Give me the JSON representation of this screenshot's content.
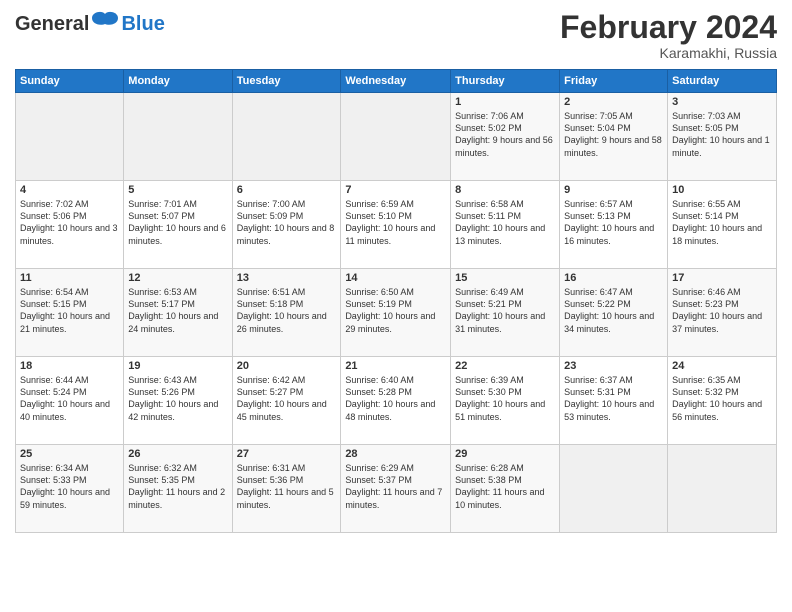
{
  "header": {
    "logo_general": "General",
    "logo_blue": "Blue",
    "title": "February 2024",
    "location": "Karamakhi, Russia"
  },
  "calendar": {
    "headers": [
      "Sunday",
      "Monday",
      "Tuesday",
      "Wednesday",
      "Thursday",
      "Friday",
      "Saturday"
    ],
    "rows": [
      [
        {
          "day": "",
          "empty": true
        },
        {
          "day": "",
          "empty": true
        },
        {
          "day": "",
          "empty": true
        },
        {
          "day": "",
          "empty": true
        },
        {
          "day": "1",
          "sunrise": "7:06 AM",
          "sunset": "5:02 PM",
          "daylight": "9 hours and 56 minutes."
        },
        {
          "day": "2",
          "sunrise": "7:05 AM",
          "sunset": "5:04 PM",
          "daylight": "9 hours and 58 minutes."
        },
        {
          "day": "3",
          "sunrise": "7:03 AM",
          "sunset": "5:05 PM",
          "daylight": "10 hours and 1 minute."
        }
      ],
      [
        {
          "day": "4",
          "sunrise": "7:02 AM",
          "sunset": "5:06 PM",
          "daylight": "10 hours and 3 minutes."
        },
        {
          "day": "5",
          "sunrise": "7:01 AM",
          "sunset": "5:07 PM",
          "daylight": "10 hours and 6 minutes."
        },
        {
          "day": "6",
          "sunrise": "7:00 AM",
          "sunset": "5:09 PM",
          "daylight": "10 hours and 8 minutes."
        },
        {
          "day": "7",
          "sunrise": "6:59 AM",
          "sunset": "5:10 PM",
          "daylight": "10 hours and 11 minutes."
        },
        {
          "day": "8",
          "sunrise": "6:58 AM",
          "sunset": "5:11 PM",
          "daylight": "10 hours and 13 minutes."
        },
        {
          "day": "9",
          "sunrise": "6:57 AM",
          "sunset": "5:13 PM",
          "daylight": "10 hours and 16 minutes."
        },
        {
          "day": "10",
          "sunrise": "6:55 AM",
          "sunset": "5:14 PM",
          "daylight": "10 hours and 18 minutes."
        }
      ],
      [
        {
          "day": "11",
          "sunrise": "6:54 AM",
          "sunset": "5:15 PM",
          "daylight": "10 hours and 21 minutes."
        },
        {
          "day": "12",
          "sunrise": "6:53 AM",
          "sunset": "5:17 PM",
          "daylight": "10 hours and 24 minutes."
        },
        {
          "day": "13",
          "sunrise": "6:51 AM",
          "sunset": "5:18 PM",
          "daylight": "10 hours and 26 minutes."
        },
        {
          "day": "14",
          "sunrise": "6:50 AM",
          "sunset": "5:19 PM",
          "daylight": "10 hours and 29 minutes."
        },
        {
          "day": "15",
          "sunrise": "6:49 AM",
          "sunset": "5:21 PM",
          "daylight": "10 hours and 31 minutes."
        },
        {
          "day": "16",
          "sunrise": "6:47 AM",
          "sunset": "5:22 PM",
          "daylight": "10 hours and 34 minutes."
        },
        {
          "day": "17",
          "sunrise": "6:46 AM",
          "sunset": "5:23 PM",
          "daylight": "10 hours and 37 minutes."
        }
      ],
      [
        {
          "day": "18",
          "sunrise": "6:44 AM",
          "sunset": "5:24 PM",
          "daylight": "10 hours and 40 minutes."
        },
        {
          "day": "19",
          "sunrise": "6:43 AM",
          "sunset": "5:26 PM",
          "daylight": "10 hours and 42 minutes."
        },
        {
          "day": "20",
          "sunrise": "6:42 AM",
          "sunset": "5:27 PM",
          "daylight": "10 hours and 45 minutes."
        },
        {
          "day": "21",
          "sunrise": "6:40 AM",
          "sunset": "5:28 PM",
          "daylight": "10 hours and 48 minutes."
        },
        {
          "day": "22",
          "sunrise": "6:39 AM",
          "sunset": "5:30 PM",
          "daylight": "10 hours and 51 minutes."
        },
        {
          "day": "23",
          "sunrise": "6:37 AM",
          "sunset": "5:31 PM",
          "daylight": "10 hours and 53 minutes."
        },
        {
          "day": "24",
          "sunrise": "6:35 AM",
          "sunset": "5:32 PM",
          "daylight": "10 hours and 56 minutes."
        }
      ],
      [
        {
          "day": "25",
          "sunrise": "6:34 AM",
          "sunset": "5:33 PM",
          "daylight": "10 hours and 59 minutes."
        },
        {
          "day": "26",
          "sunrise": "6:32 AM",
          "sunset": "5:35 PM",
          "daylight": "11 hours and 2 minutes."
        },
        {
          "day": "27",
          "sunrise": "6:31 AM",
          "sunset": "5:36 PM",
          "daylight": "11 hours and 5 minutes."
        },
        {
          "day": "28",
          "sunrise": "6:29 AM",
          "sunset": "5:37 PM",
          "daylight": "11 hours and 7 minutes."
        },
        {
          "day": "29",
          "sunrise": "6:28 AM",
          "sunset": "5:38 PM",
          "daylight": "11 hours and 10 minutes."
        },
        {
          "day": "",
          "empty": true
        },
        {
          "day": "",
          "empty": true
        }
      ]
    ]
  }
}
